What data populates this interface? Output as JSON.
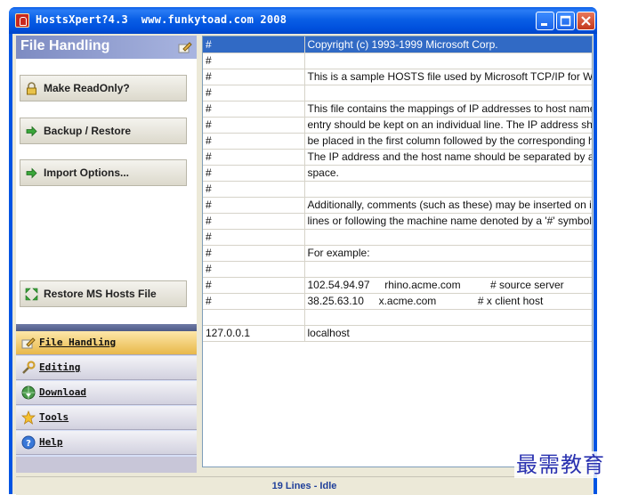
{
  "window": {
    "title": "HostsXpert?4.3  www.funkytoad.com 2008"
  },
  "left_panel": {
    "title": "File Handling",
    "actions": [
      {
        "label": "Make ReadOnly?",
        "icon": "lock-icon"
      },
      {
        "label": "Backup / Restore",
        "icon": "green-arrow-icon"
      },
      {
        "label": "Import Options...",
        "icon": "green-arrow-icon"
      },
      {
        "label": "Restore MS Hosts File",
        "icon": "restore-arrows-icon"
      }
    ],
    "nav": [
      {
        "label": "File Handling",
        "icon": "pencil-icon",
        "active": true
      },
      {
        "label": "Editing",
        "icon": "wrench-icon",
        "active": false
      },
      {
        "label": "Download",
        "icon": "globe-download-icon",
        "active": false
      },
      {
        "label": "Tools",
        "icon": "star-icon",
        "active": false
      },
      {
        "label": "Help",
        "icon": "help-icon",
        "active": false
      }
    ]
  },
  "hosts_grid": {
    "rows": [
      {
        "c1": "#",
        "c2": "Copyright (c) 1993-1999 Microsoft Corp.",
        "selected": true
      },
      {
        "c1": "#",
        "c2": ""
      },
      {
        "c1": "#",
        "c2": "This is a sample HOSTS file used by Microsoft TCP/IP for Windows."
      },
      {
        "c1": "#",
        "c2": ""
      },
      {
        "c1": "#",
        "c2": "This file contains the mappings of IP addresses to host names. Each"
      },
      {
        "c1": "#",
        "c2": "entry should be kept on an individual line. The IP address should"
      },
      {
        "c1": "#",
        "c2": "be placed in the first column followed by the corresponding host name."
      },
      {
        "c1": "#",
        "c2": "The IP address and the host name should be separated by at least one"
      },
      {
        "c1": "#",
        "c2": "space."
      },
      {
        "c1": "#",
        "c2": ""
      },
      {
        "c1": "#",
        "c2": "Additionally, comments (such as these) may be inserted on individual"
      },
      {
        "c1": "#",
        "c2": "lines or following the machine name denoted by a '#' symbol."
      },
      {
        "c1": "#",
        "c2": ""
      },
      {
        "c1": "#",
        "c2": "For example:"
      },
      {
        "c1": "#",
        "c2": ""
      },
      {
        "c1": "#",
        "c2": "102.54.94.97     rhino.acme.com          # source server"
      },
      {
        "c1": "#",
        "c2": "38.25.63.10     x.acme.com              # x client host"
      },
      {
        "c1": "",
        "c2": ""
      },
      {
        "c1": "127.0.0.1",
        "c2": "localhost"
      }
    ]
  },
  "status": {
    "text": "19 Lines - Idle"
  },
  "watermark": {
    "text": "最需教育"
  },
  "colors": {
    "titlebar": "#0054e3",
    "selection": "#316ac5",
    "status_text": "#1f3f9a",
    "watermark": "#2a32b0"
  }
}
